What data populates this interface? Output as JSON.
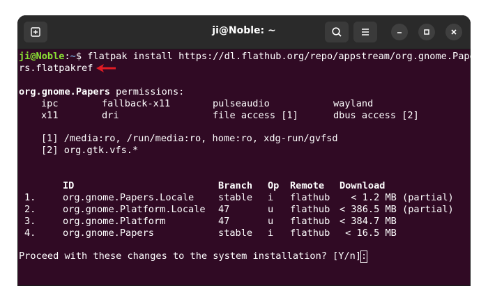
{
  "window": {
    "title": "ji@Noble: ~",
    "icons": {
      "new_tab": "new-tab-icon",
      "search": "search-icon",
      "menu": "hamburger-menu-icon",
      "minimize": "minimize-icon",
      "maximize": "maximize-icon",
      "close": "close-icon"
    }
  },
  "terminal": {
    "prompt_user": "ji@Noble",
    "prompt_sep": ":",
    "prompt_path": "~",
    "prompt_dollar": "$",
    "command_line1": " flatpak install https://dl.flathub.org/repo/appstream/org.gnome.Pape",
    "command_line2": "rs.flatpakref",
    "annotation_arrow": "red-arrow-icon",
    "app_id_bold": "org.gnome.Papers",
    "permissions_label": " permissions:",
    "permissions": [
      [
        "ipc",
        "fallback-x11",
        "pulseaudio",
        "wayland"
      ],
      [
        "x11",
        "dri",
        "file access [1]",
        "dbus access [2]"
      ]
    ],
    "notes": [
      "[1] /media:ro, /run/media:ro, home:ro, xdg-run/gvfsd",
      "[2] org.gtk.vfs.*"
    ],
    "table": {
      "headers": [
        "ID",
        "Branch",
        "Op",
        "Remote",
        "Download"
      ],
      "rows": [
        [
          "1.",
          "org.gnome.Papers.Locale",
          "stable",
          "i",
          "flathub",
          "  < 1.2 MB (partial)"
        ],
        [
          "2.",
          "org.gnome.Platform.Locale",
          "47",
          "u",
          "flathub",
          "< 386.5 MB (partial)"
        ],
        [
          "3.",
          "org.gnome.Platform",
          "47",
          "u",
          "flathub",
          "< 384.7 MB"
        ],
        [
          "4.",
          "org.gnome.Papers",
          "stable",
          "i",
          "flathub",
          " < 16.5 MB"
        ]
      ]
    },
    "proceed_prompt": "Proceed with these changes to the system installation? [Y/n]: "
  },
  "colors": {
    "terminal_bg": "#300a24",
    "titlebar_bg": "#2a2a2a",
    "prompt_user": "#8ae234",
    "prompt_path": "#729fcf",
    "arrow": "#e01b24"
  }
}
